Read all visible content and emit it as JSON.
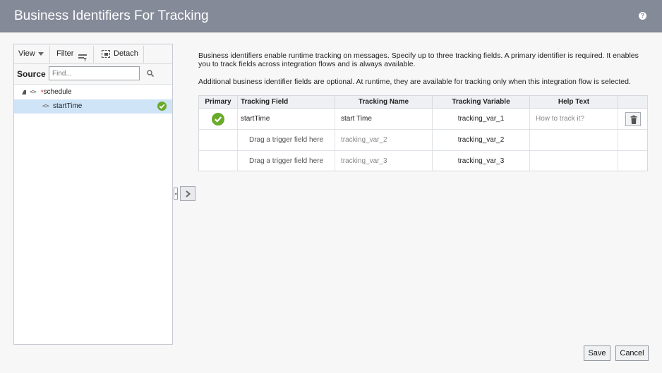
{
  "dialog": {
    "title": "Business Identifiers For Tracking",
    "help_icon": "question-circle-icon"
  },
  "toolbar": {
    "view_label": "View",
    "filter_label": "Filter",
    "detach_label": "Detach"
  },
  "source": {
    "label": "Source",
    "search_placeholder": "Find..."
  },
  "tree": {
    "root": {
      "marker": "*",
      "label": "schedule"
    },
    "child": {
      "label": "startTime",
      "status_icon": "check-circle-icon"
    }
  },
  "description": {
    "line1": "Business identifiers enable runtime tracking on messages. Specify up to three tracking fields. A primary identifier is required. It enables you to track fields across integration flows and is always available.",
    "line2": "Additional business identifier fields are optional. At runtime, they are available for tracking only when this integration flow is selected."
  },
  "grid": {
    "headers": {
      "primary": "Primary",
      "field": "Tracking Field",
      "name": "Tracking Name",
      "variable": "Tracking Variable",
      "help": "Help Text"
    },
    "rows": [
      {
        "field": "startTime",
        "name": "start Time",
        "variable": "tracking_var_1",
        "help": "How to track it?"
      },
      {
        "field": "Drag a trigger field here",
        "name": "tracking_var_2",
        "variable": "tracking_var_2",
        "help": ""
      },
      {
        "field": "Drag a trigger field here",
        "name": "tracking_var_3",
        "variable": "tracking_var_3",
        "help": ""
      }
    ]
  },
  "buttons": {
    "save": "Save",
    "cancel": "Cancel"
  },
  "colors": {
    "titlebar": "#858a99",
    "success": "#6aaa2a",
    "selection": "#cfe4f7"
  }
}
